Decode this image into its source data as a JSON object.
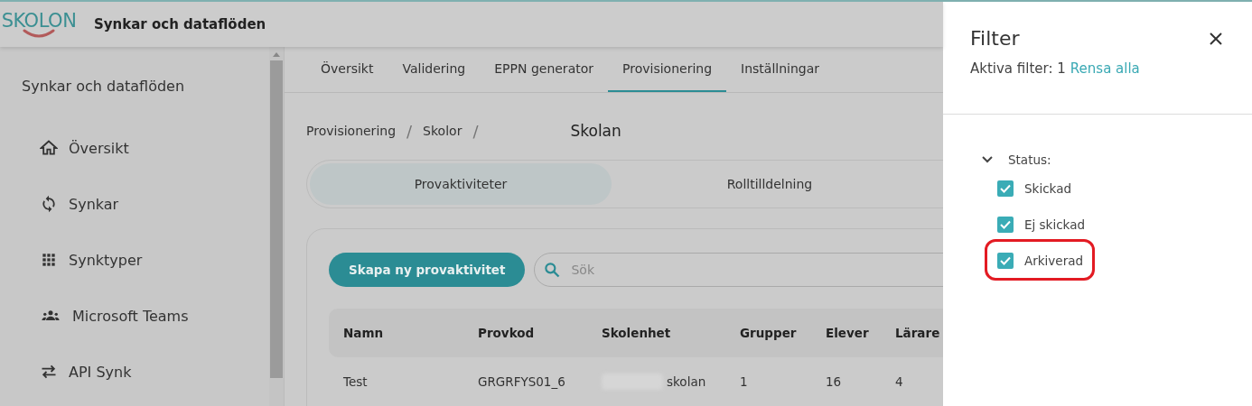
{
  "header": {
    "logo": "SKOLON",
    "title": "Synkar och dataflöden"
  },
  "sidebar": {
    "heading": "Synkar och dataflöden",
    "items": [
      {
        "label": "Översikt"
      },
      {
        "label": "Synkar"
      },
      {
        "label": "Synktyper"
      },
      {
        "label": "Microsoft Teams"
      },
      {
        "label": "API Synk"
      }
    ]
  },
  "tabs": [
    {
      "label": "Översikt",
      "selected": false
    },
    {
      "label": "Validering",
      "selected": false
    },
    {
      "label": "EPPN generator",
      "selected": false
    },
    {
      "label": "Provisionering",
      "selected": true
    },
    {
      "label": "Inställningar",
      "selected": false
    }
  ],
  "breadcrumb": [
    {
      "label": "Provisionering",
      "separator": "/"
    },
    {
      "label": "Skolor",
      "separator": "/"
    }
  ],
  "page_title": "Skolan",
  "segments": [
    {
      "label": "Provaktiviteter",
      "selected": true
    },
    {
      "label": "Rolltilldelning",
      "selected": false
    }
  ],
  "create_button": "Skapa ny provaktivitet",
  "search": {
    "placeholder": "Sök"
  },
  "table": {
    "columns": [
      "Namn",
      "Provkod",
      "Skolenhet",
      "Grupper",
      "Elever",
      "Lärare"
    ],
    "rows": [
      [
        "Test",
        "GRGRFYS01_6",
        "skolan",
        "1",
        "16",
        "4"
      ]
    ]
  },
  "filter": {
    "title": "Filter",
    "active_label": "Aktiva filter: 1",
    "clear_link": "Rensa alla",
    "group": {
      "label": "Status:",
      "expanded": true,
      "options": [
        {
          "label": "Skickad",
          "checked": true,
          "highlighted": false
        },
        {
          "label": "Ej skickad",
          "checked": true,
          "highlighted": false
        },
        {
          "label": "Arkiverad",
          "checked": true,
          "highlighted": true
        }
      ]
    }
  }
}
